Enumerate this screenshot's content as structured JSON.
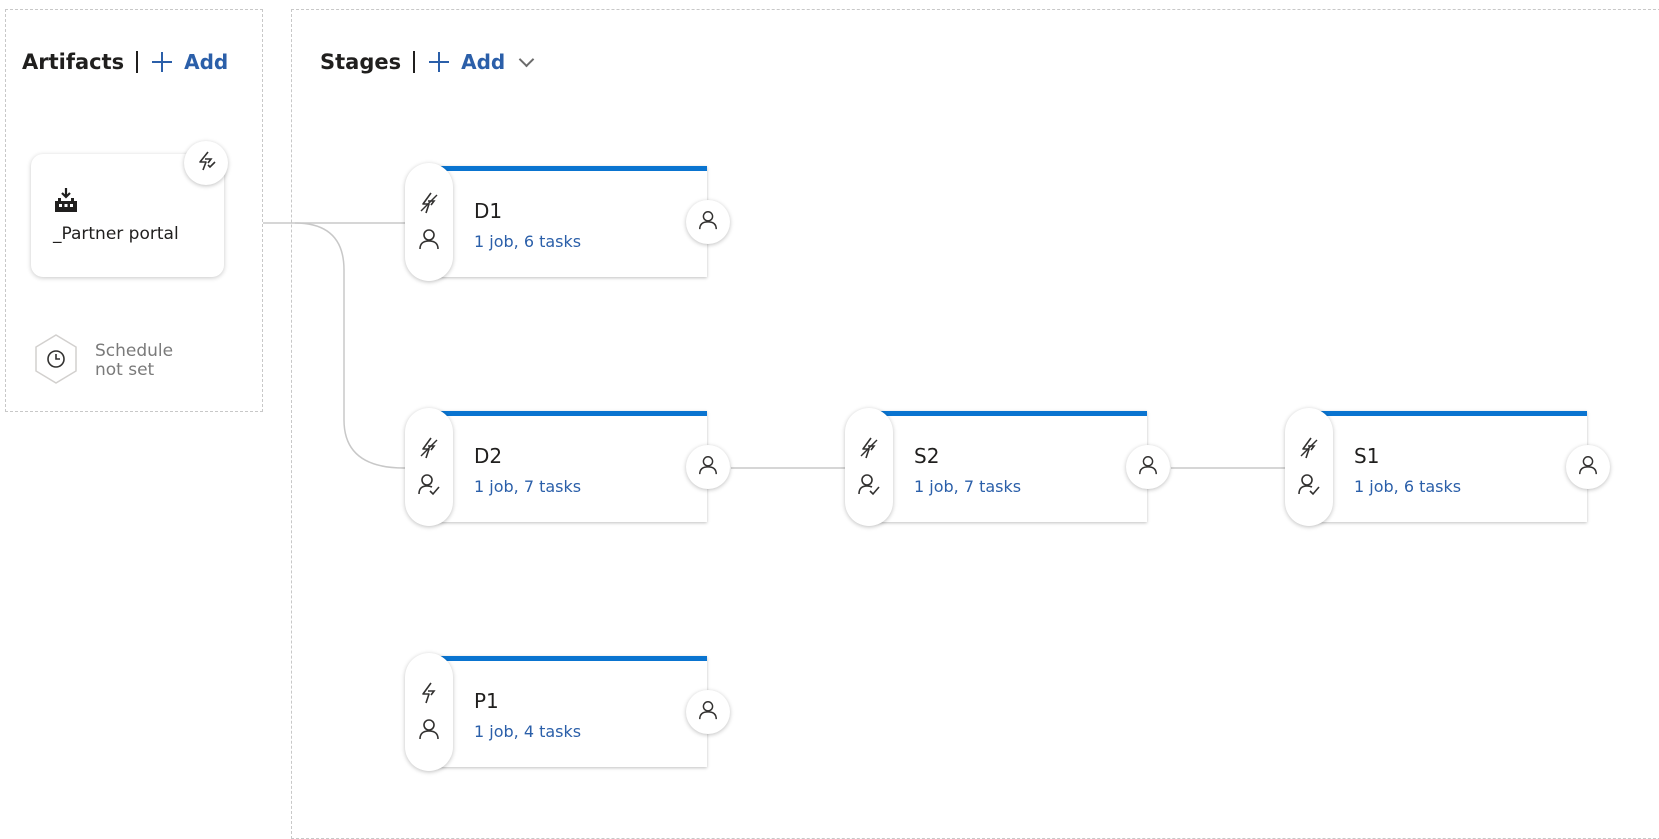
{
  "artifacts": {
    "title": "Artifacts",
    "add_label": "Add",
    "items": [
      {
        "name": "_Partner portal",
        "icon": "build-artifact-icon",
        "trigger_icon": "continuous-deployment-trigger-icon"
      }
    ],
    "schedule": {
      "line1": "Schedule",
      "line2": "not set",
      "icon": "clock-icon"
    }
  },
  "stages": {
    "title": "Stages",
    "add_label": "Add",
    "items": [
      {
        "name": "D1",
        "summary": "1 job, 6 tasks",
        "trigger_icon": "lightning-disabled-icon",
        "approval_icon": "person-icon"
      },
      {
        "name": "D2",
        "summary": "1 job, 7 tasks",
        "trigger_icon": "lightning-disabled-icon",
        "approval_icon": "person-check-icon"
      },
      {
        "name": "S2",
        "summary": "1 job, 7 tasks",
        "trigger_icon": "lightning-disabled-icon",
        "approval_icon": "person-check-icon"
      },
      {
        "name": "S1",
        "summary": "1 job, 6 tasks",
        "trigger_icon": "lightning-disabled-icon",
        "approval_icon": "person-check-icon"
      },
      {
        "name": "P1",
        "summary": "1 job, 4 tasks",
        "trigger_icon": "lightning-icon",
        "approval_icon": "person-icon"
      }
    ]
  },
  "colors": {
    "accent": "#0a74d0",
    "link": "#2b5fa9",
    "connector": "#c8c8c8"
  }
}
